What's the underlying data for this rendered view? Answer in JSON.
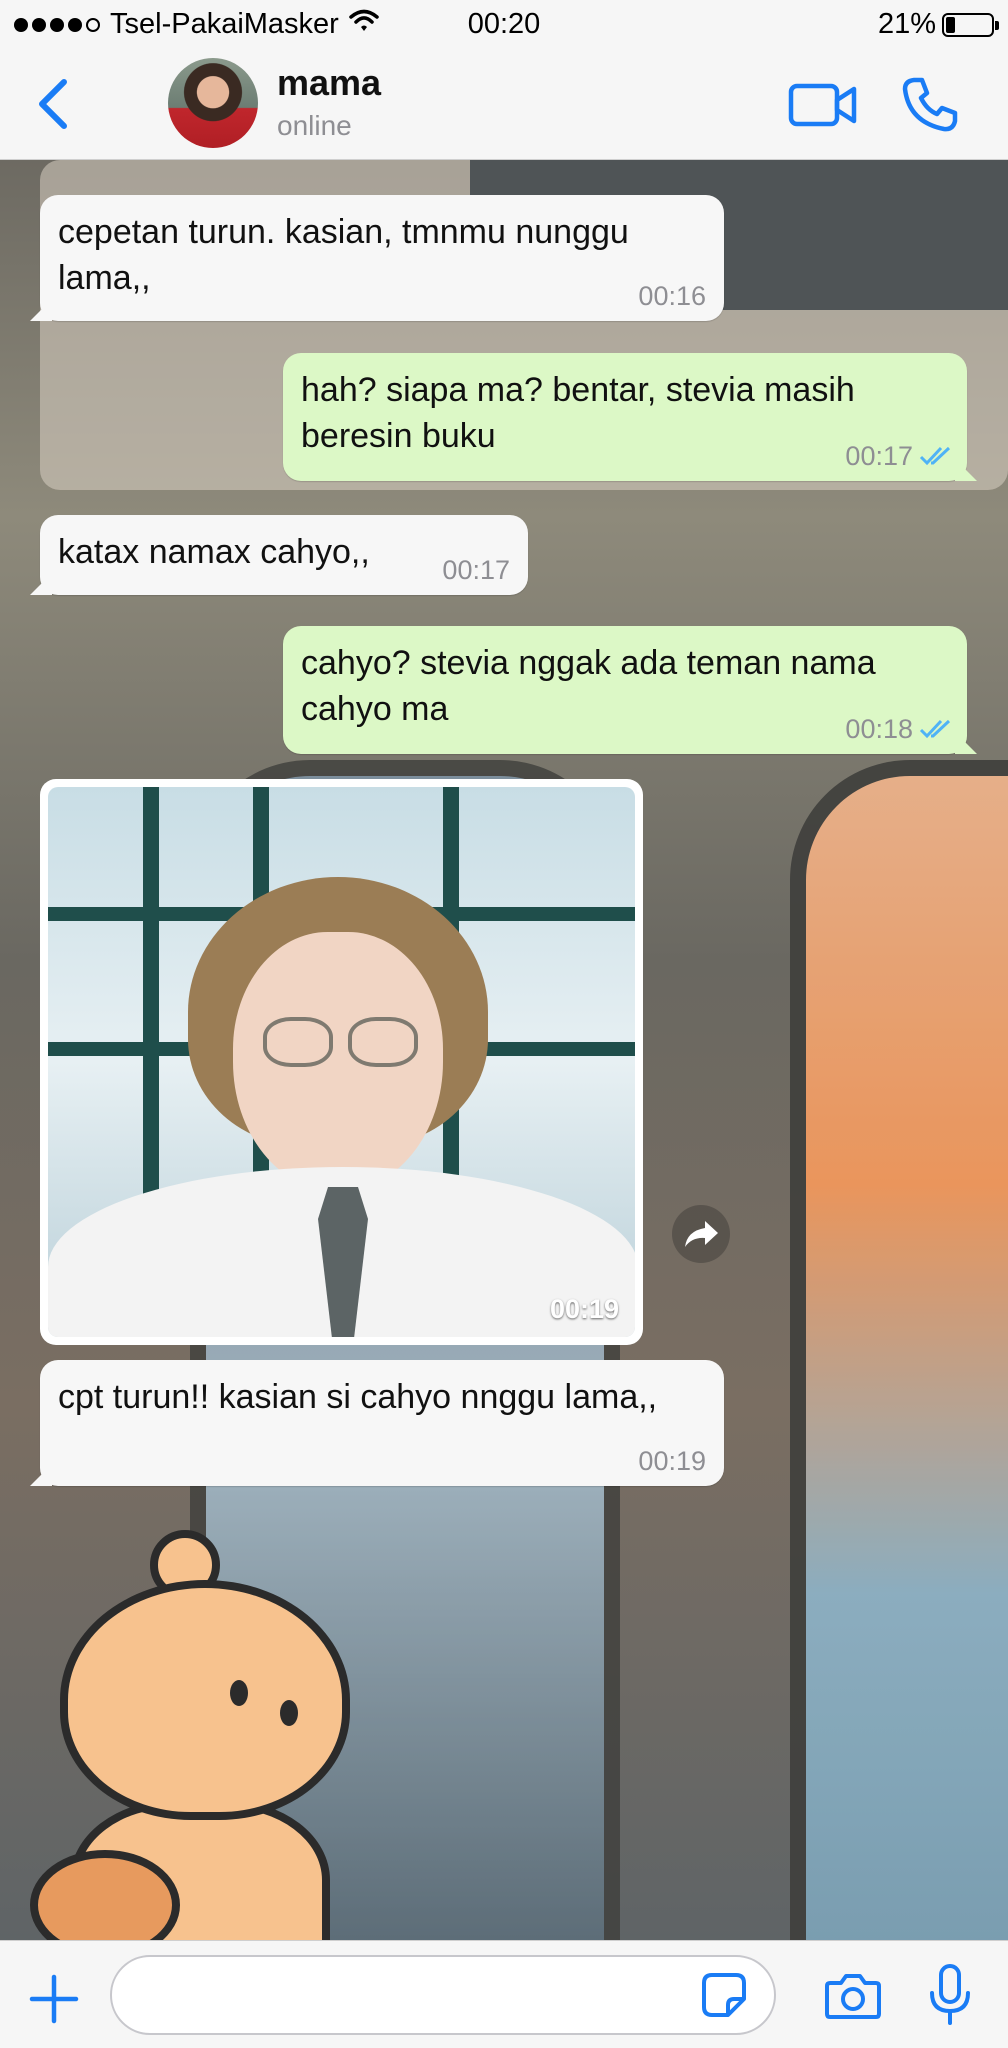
{
  "status_bar": {
    "carrier": "Tsel-PakaiMasker",
    "time": "00:20",
    "battery": "21%",
    "battery_level": 0.21
  },
  "header": {
    "back_icon": "chevron-left-icon",
    "contact_name": "mama",
    "contact_status": "online",
    "video_icon": "video-camera-icon",
    "call_icon": "phone-icon",
    "accent_color": "#1a7cf5"
  },
  "messages": [
    {
      "direction": "incoming",
      "text": "cepetan turun. kasian, tmnmu nunggu lama,,",
      "time": "00:16"
    },
    {
      "direction": "outgoing",
      "text": "hah? siapa ma? bentar, stevia masih beresin buku",
      "time": "00:17",
      "status": "read"
    },
    {
      "direction": "incoming",
      "text": "katax namax cahyo,,",
      "time": "00:17"
    },
    {
      "direction": "outgoing",
      "text": "cahyo? stevia nggak ada teman nama cahyo ma",
      "time": "00:18",
      "status": "read"
    },
    {
      "direction": "incoming",
      "type": "image",
      "time": "00:19"
    },
    {
      "direction": "incoming",
      "text": "cpt turun!! kasian si cahyo nnggu lama,,",
      "time": "00:19"
    }
  ],
  "input_bar": {
    "placeholder": "",
    "attach_icon": "plus-icon",
    "sticker_icon": "sticker-icon",
    "camera_icon": "camera-icon",
    "mic_icon": "microphone-icon"
  },
  "colors": {
    "incoming_bubble": "#f7f7f7",
    "outgoing_bubble": "#dcf8c6",
    "read_receipt": "#4fb3f6",
    "timestamp": "#8e8e93"
  }
}
